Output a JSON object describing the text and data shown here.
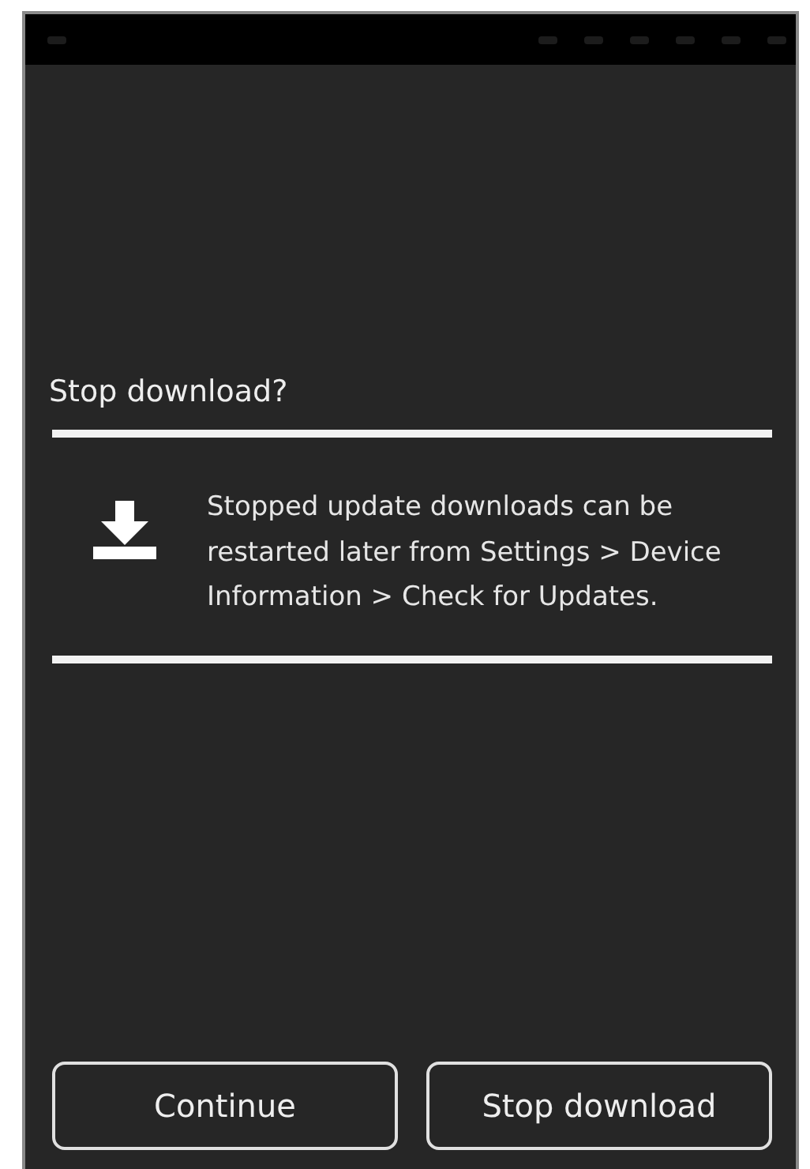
{
  "dialog": {
    "title": "Stop download?",
    "message": "Stopped update downloads can be restarted later from Settings > Device Information > Check for Updates."
  },
  "buttons": [
    {
      "label": "Continue"
    },
    {
      "label": "Stop download"
    }
  ]
}
